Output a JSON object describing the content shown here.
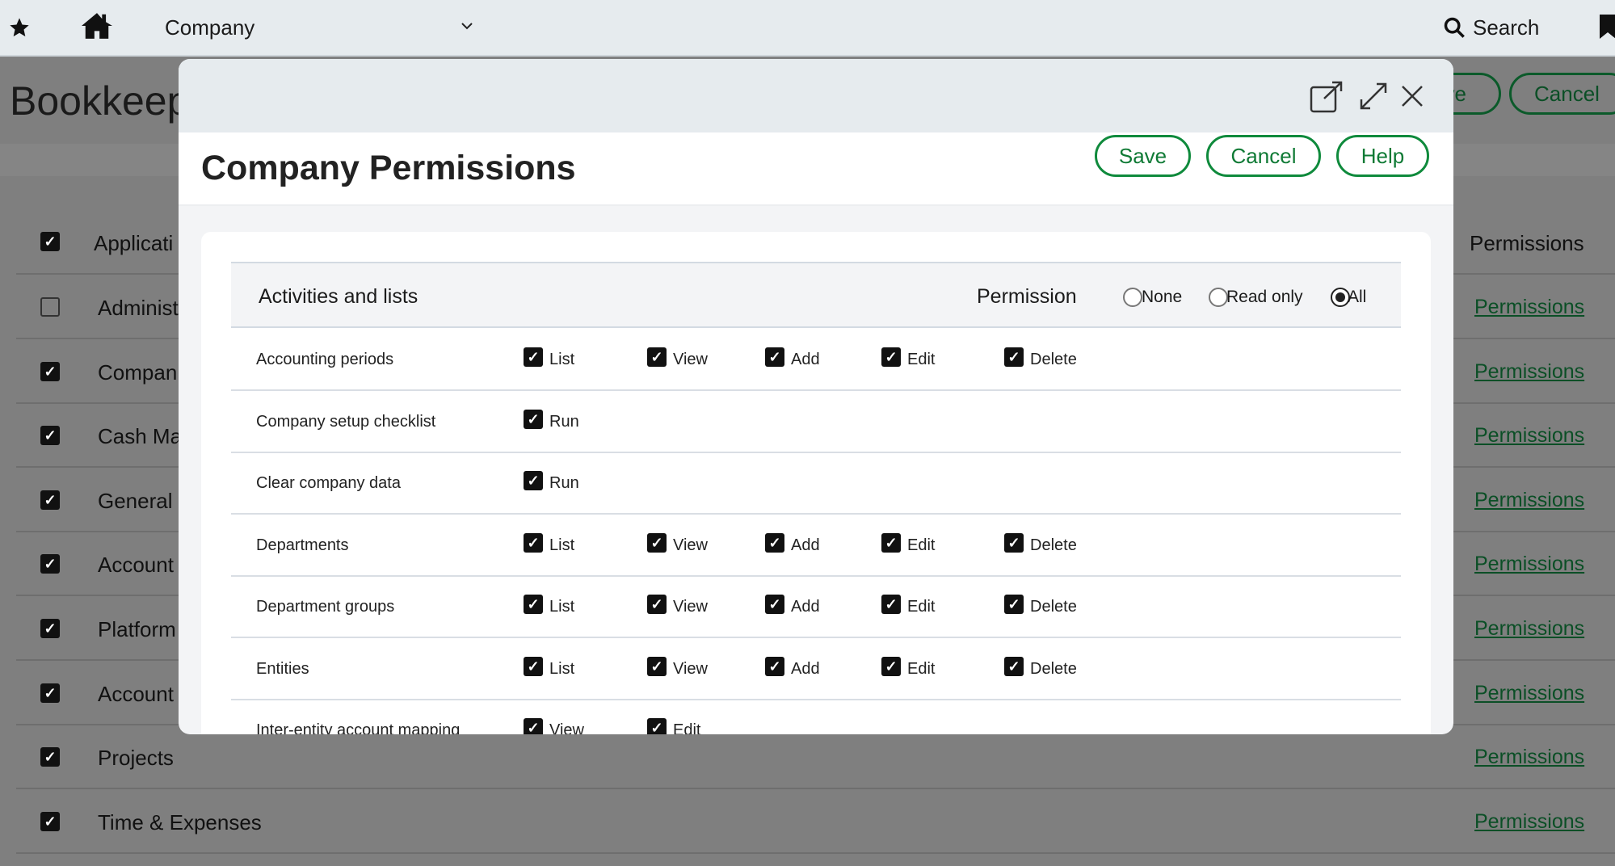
{
  "topbar": {
    "company": "Company",
    "search": "Search"
  },
  "background": {
    "title": "Bookkeep",
    "save_partial": "ve",
    "cancel": "Cancel",
    "header_label": "Applicati",
    "header_permissions": "Permissions",
    "rows": [
      {
        "name": "Administ",
        "checked": false
      },
      {
        "name": "Compan",
        "checked": true
      },
      {
        "name": "Cash Ma",
        "checked": true
      },
      {
        "name": "General",
        "checked": true
      },
      {
        "name": "Account",
        "checked": true
      },
      {
        "name": "Platform",
        "checked": true
      },
      {
        "name": "Account",
        "checked": true
      },
      {
        "name": "Projects",
        "checked": true
      },
      {
        "name": "Time & Expenses",
        "checked": true
      }
    ],
    "link": "Permissions"
  },
  "modal": {
    "title": "Company Permissions",
    "save": "Save",
    "cancel": "Cancel",
    "help": "Help",
    "section": "Activities and lists",
    "permission_label": "Permission",
    "permission_options": [
      "None",
      "Read only",
      "All"
    ],
    "permission_selected": "All",
    "rows": [
      {
        "name": "Accounting periods",
        "perms": [
          "List",
          "View",
          "Add",
          "Edit",
          "Delete"
        ]
      },
      {
        "name": "Company setup checklist",
        "perms": [
          "Run"
        ]
      },
      {
        "name": "Clear company data",
        "perms": [
          "Run"
        ]
      },
      {
        "name": "Departments",
        "perms": [
          "List",
          "View",
          "Add",
          "Edit",
          "Delete"
        ]
      },
      {
        "name": "Department groups",
        "perms": [
          "List",
          "View",
          "Add",
          "Edit",
          "Delete"
        ]
      },
      {
        "name": "Entities",
        "perms": [
          "List",
          "View",
          "Add",
          "Edit",
          "Delete"
        ]
      },
      {
        "name": "Inter-entity account mapping",
        "perms": [
          "View",
          "Edit"
        ]
      }
    ]
  }
}
